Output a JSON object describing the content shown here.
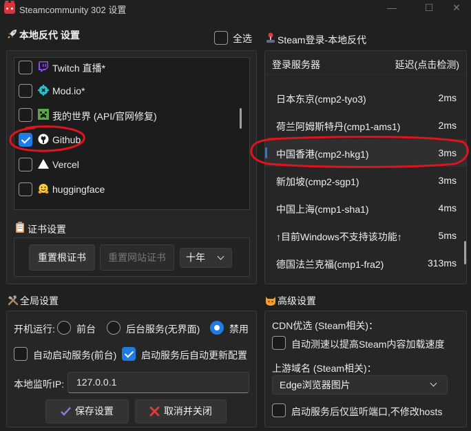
{
  "window": {
    "title": "Steamcommunity 302 设置",
    "minimize_glyph": "—",
    "maximize_glyph": "☐",
    "close_glyph": "✕"
  },
  "local_proxy": {
    "title": "本地反代 设置",
    "title_icon": "rocket-icon",
    "select_all_label": "全选",
    "select_all_checked": false,
    "items": [
      {
        "label": "Twitch 直播*",
        "icon": "twitch-icon",
        "icon_color": "#9146ff",
        "checked": false
      },
      {
        "label": "Mod.io*",
        "icon": "modio-icon",
        "icon_color": "#23c0d0",
        "checked": false
      },
      {
        "label": "我的世界 (API/官网修复)",
        "icon": "minecraft-icon",
        "icon_color": "#5aa544",
        "checked": false
      },
      {
        "label": "Github",
        "icon": "github-icon",
        "icon_color": "#ffffff",
        "checked": true
      },
      {
        "label": "Vercel",
        "icon": "vercel-icon",
        "icon_color": "#ffffff",
        "checked": false
      },
      {
        "label": "huggingface",
        "icon": "huggingface-icon",
        "icon_color": "#ffcc33",
        "checked": false
      }
    ]
  },
  "cert": {
    "title": "证书设置",
    "title_icon": "clipboard-icon",
    "reset_root_label": "重置根证书",
    "reset_site_label": "重置网站证书",
    "period_value": "十年"
  },
  "steam_login": {
    "title": "Steam登录-本地反代",
    "title_icon": "joystick-icon",
    "col_server": "登录服务器",
    "col_latency": "延迟(点击检测)",
    "servers": [
      {
        "name": "日本东京(cmp2-tyo3)",
        "latency": "2ms",
        "selected": false
      },
      {
        "name": "荷兰阿姆斯特丹(cmp1-ams1)",
        "latency": "2ms",
        "selected": false
      },
      {
        "name": "中国香港(cmp2-hkg1)",
        "latency": "3ms",
        "selected": true
      },
      {
        "name": "新加坡(cmp2-sgp1)",
        "latency": "3ms",
        "selected": false
      },
      {
        "name": "中国上海(cmp1-sha1)",
        "latency": "4ms",
        "selected": false
      },
      {
        "name": "↑目前Windows不支持该功能↑",
        "latency": "5ms",
        "selected": false
      },
      {
        "name": "德国法兰克福(cmp1-fra2)",
        "latency": "313ms",
        "selected": false
      }
    ]
  },
  "global": {
    "title": "全局设置",
    "title_icon": "tools-icon",
    "startup_label": "开机运行:",
    "startup_options": [
      "前台",
      "后台服务(无界面)",
      "禁用"
    ],
    "startup_selected": "禁用",
    "auto_start_label": "自动启动服务(前台)",
    "auto_start_checked": false,
    "auto_update_label": "启动服务后自动更新配置",
    "auto_update_checked": true,
    "listen_ip_label": "本地监听IP:",
    "listen_ip_value": "127.0.0.1",
    "save_label": "保存设置",
    "cancel_label": "取消并关闭"
  },
  "advanced": {
    "title": "高级设置",
    "title_icon": "cat-icon",
    "cdn_label": "CDN优选 (Steam相关)：",
    "cdn_auto_label": "自动测速以提高Steam内容加载速度",
    "cdn_auto_checked": false,
    "upstream_label": "上游域名 (Steam相关)：",
    "upstream_value": "Edge浏览器图片",
    "listen_only_label": "启动服务后仅监听端口,不修改hosts",
    "listen_only_checked": false
  },
  "colors": {
    "accent": "#1f7be6",
    "annotation_red": "#e0141e"
  }
}
